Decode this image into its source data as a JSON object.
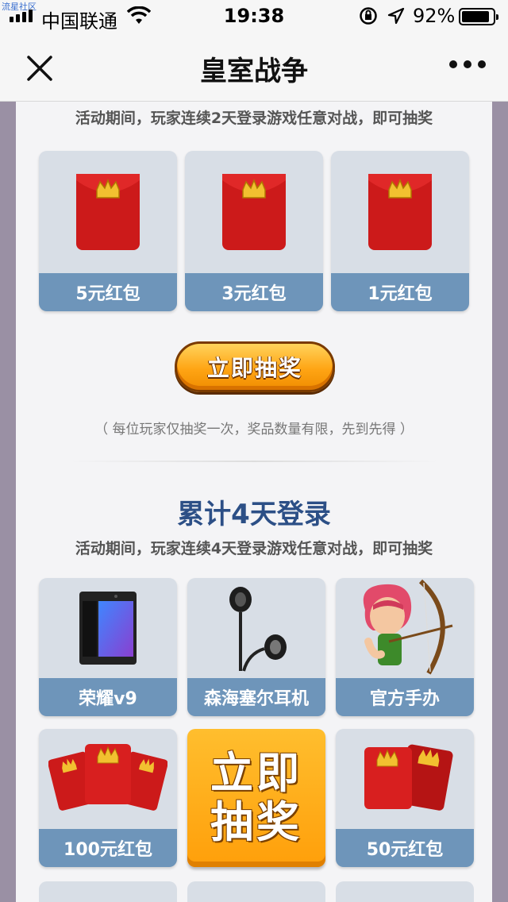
{
  "status_bar": {
    "watermark": "流星社区",
    "carrier": "中国联通",
    "time": "19:38",
    "battery": "92%",
    "battery_level": 0.92
  },
  "nav": {
    "title": "皇室战争"
  },
  "section_2day": {
    "rule": "活动期间，玩家连续2天登录游戏任意对战，即可抽奖",
    "prizes": [
      {
        "label": "5元红包",
        "icon": "red-envelope-icon"
      },
      {
        "label": "3元红包",
        "icon": "red-envelope-icon"
      },
      {
        "label": "1元红包",
        "icon": "red-envelope-icon"
      }
    ],
    "draw_button": "立即抽奖",
    "note": "（ 每位玩家仅抽奖一次，奖品数量有限，先到先得 ）"
  },
  "section_4day": {
    "title": "累计4天登录",
    "rule": "活动期间，玩家连续4天登录游戏任意对战，即可抽奖",
    "prizes": [
      {
        "label": "荣耀v9",
        "icon": "phone-icon"
      },
      {
        "label": "森海塞尔耳机",
        "icon": "earphones-icon"
      },
      {
        "label": "官方手办",
        "icon": "archer-figure-icon"
      },
      {
        "label": "100元红包",
        "icon": "red-envelopes-icon"
      },
      {
        "label": "50元红包",
        "icon": "red-envelopes-icon"
      }
    ],
    "big_draw_line1": "立即",
    "big_draw_line2": "抽奖"
  },
  "colors": {
    "card_label": "#6e95ba",
    "section_title": "#2c4f86",
    "button_orange": "#ffa514"
  }
}
